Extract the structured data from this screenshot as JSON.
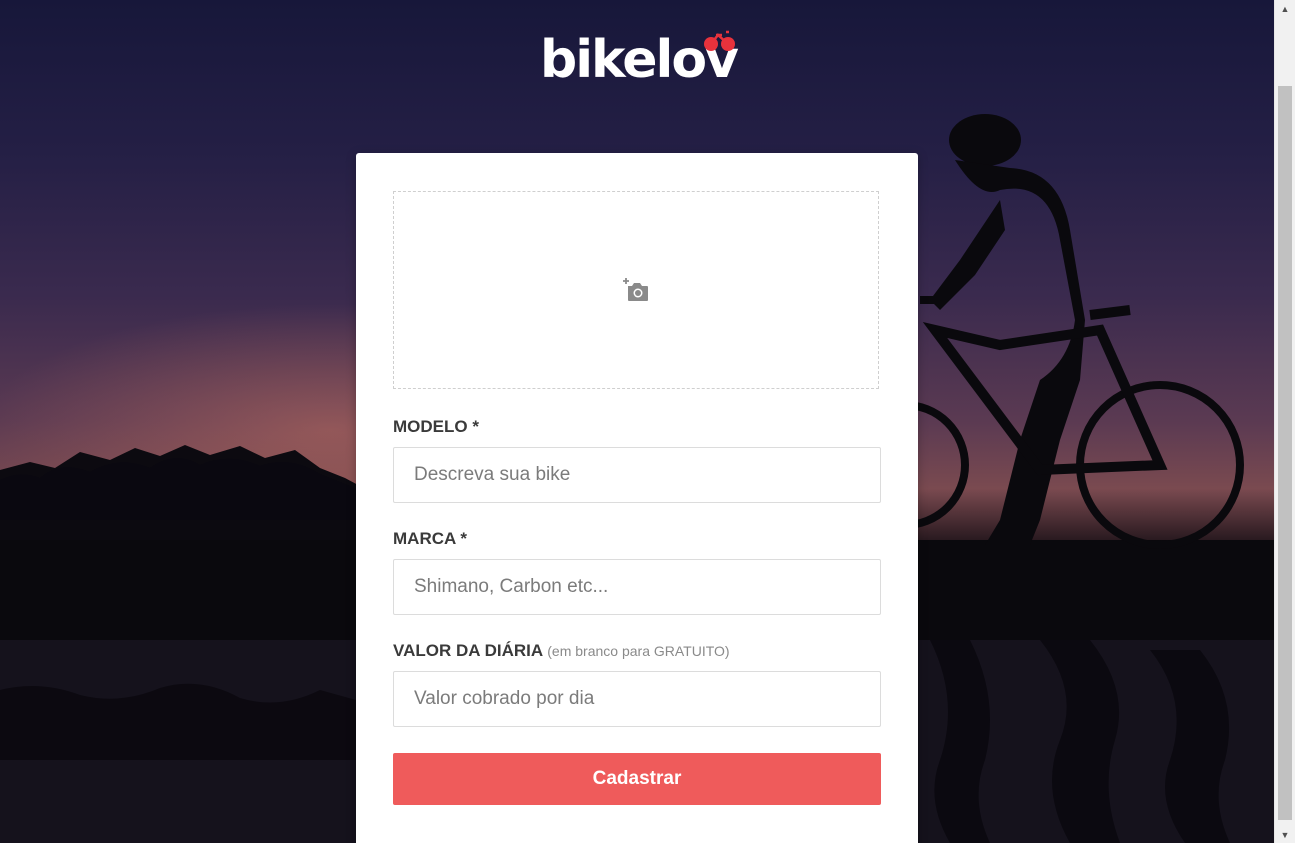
{
  "brand": {
    "name": "bikelov",
    "accent_color": "#e8323c"
  },
  "form": {
    "photo_upload_icon": "add-photo-camera-icon",
    "fields": [
      {
        "label": "MODELO *",
        "hint": "",
        "placeholder": "Descreva sua bike",
        "value": ""
      },
      {
        "label": "MARCA *",
        "hint": "",
        "placeholder": "Shimano, Carbon etc...",
        "value": ""
      },
      {
        "label": "VALOR DA DIÁRIA",
        "hint": "(em branco para GRATUITO)",
        "placeholder": "Valor cobrado por dia",
        "value": ""
      }
    ],
    "submit_label": "Cadastrar",
    "submit_color": "#ef5b5b"
  }
}
